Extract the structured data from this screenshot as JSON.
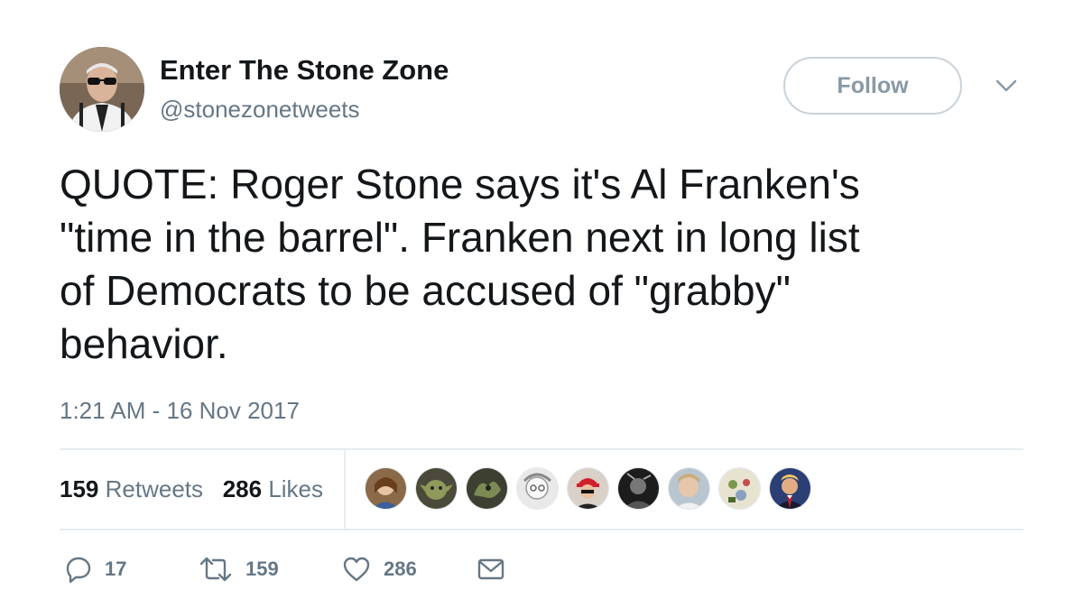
{
  "tweet": {
    "author_name": "Enter The Stone Zone",
    "author_handle": "@stonezonetweets",
    "follow_label": "Follow",
    "text": "QUOTE: Roger Stone says it's Al Franken's\n\"time in the barrel\". Franken next in long list\nof Democrats to be accused of \"grabby\"\nbehavior.",
    "timestamp": "1:21 AM - 16 Nov 2017"
  },
  "stats": {
    "retweets_count": "159",
    "retweets_label": "Retweets",
    "likes_count": "286",
    "likes_label": "Likes",
    "liker_avatar_count": 9
  },
  "actions": {
    "reply_count": "17",
    "retweet_count": "159",
    "like_count": "286"
  },
  "icons": {
    "reply": "reply-icon",
    "retweet": "retweet-icon",
    "like": "heart-icon",
    "message": "envelope-icon",
    "more": "chevron-down-icon"
  },
  "colors": {
    "text": "#14171a",
    "secondary": "#657786",
    "border": "#e6ecf0",
    "follow_border": "#c9d2d9"
  }
}
